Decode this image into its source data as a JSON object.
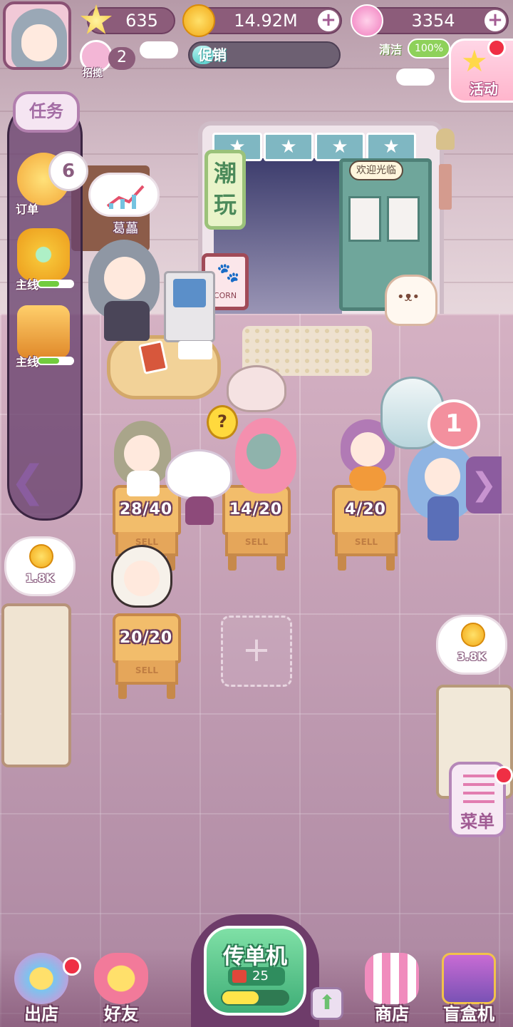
{
  "hud": {
    "stars": "635",
    "coins": "14.92M",
    "gems": "3354",
    "recruit_count": "2",
    "recruit_label": "招揽",
    "promo_label": "促销",
    "promo_progress": 0.15,
    "clean_label": "清洁",
    "clean_value": "100%",
    "activity_label": "活动",
    "add_symbol": "+"
  },
  "tasks": {
    "title": "任务",
    "order_label": "订单",
    "order_count": "6",
    "main1_label": "主线",
    "main1_progress": 0.6,
    "main2_label": "主线",
    "main2_progress": 0.6
  },
  "shop": {
    "sign_text": "潮玩",
    "welcome_text": "欢迎光临",
    "board_text": "CORN",
    "clerk_name": "葛藟"
  },
  "seats": [
    {
      "count": "28/40",
      "label": "SELL"
    },
    {
      "count": "14/20",
      "label": "SELL"
    },
    {
      "count": "4/20",
      "label": "SELL"
    },
    {
      "count": "20/20",
      "label": "SELL"
    }
  ],
  "bubbles": {
    "left_coin": "1.8K",
    "right_coin": "3.8K",
    "queue": "1"
  },
  "menu_label": "菜单",
  "nav": {
    "go_out": "出店",
    "friends": "好友",
    "flyer": "传单机",
    "flyer_count": "25",
    "flyer_progress": 0.55,
    "shop": "商店",
    "blind_box": "盲盒机"
  },
  "colors": {
    "accent": "#8c5c7a",
    "gold": "#f2a817",
    "green": "#3fae77",
    "alert": "#ef2f44"
  }
}
